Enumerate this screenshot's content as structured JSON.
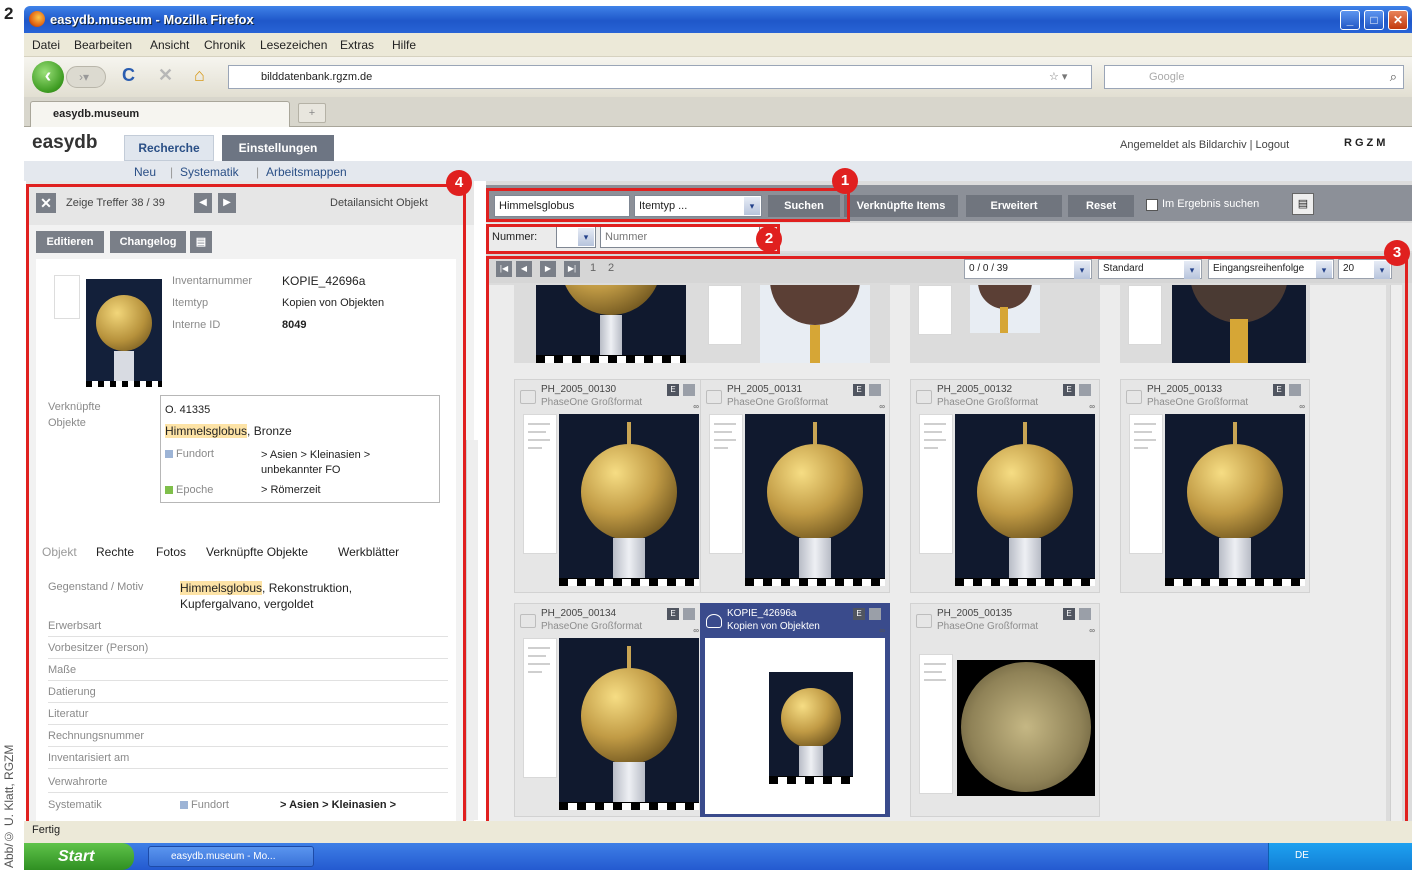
{
  "figure_number": "2",
  "photo_credit": "Abb/© U. Klatt, RGZM",
  "window": {
    "title": "easydb.museum - Mozilla Firefox"
  },
  "menu": [
    "Datei",
    "Bearbeiten",
    "Ansicht",
    "Chronik",
    "Lesezeichen",
    "Extras",
    "Hilfe"
  ],
  "browser": {
    "url": "bilddatenbank.rgzm.de",
    "search_placeholder": "Google",
    "tab_title": "easydb.museum",
    "new_tab": "+"
  },
  "app": {
    "logo": "easydb",
    "tabs": [
      "Recherche",
      "Einstellungen"
    ],
    "login_text": "Angemeldet als Bildarchiv | Logout",
    "brand": "RGZM",
    "subnav": [
      "Neu",
      "Systematik",
      "Arbeitsmappen"
    ]
  },
  "detail": {
    "hits": "Zeige Treffer 38 / 39",
    "view_label": "Detailansicht Objekt",
    "edit": "Editieren",
    "changelog": "Changelog",
    "fields": [
      {
        "label": "Inventarnummer",
        "value": "KOPIE_42696a"
      },
      {
        "label": "Itemtyp",
        "value": "Kopien von Objekten"
      },
      {
        "label": "Interne ID",
        "value": "8049"
      }
    ],
    "linked_label": "Verknüpfte Objekte",
    "linked": {
      "number": "O. 41335",
      "highlight": "Himmelsglobus",
      "rest": ", Bronze",
      "fundort_label": "Fundort",
      "fundort": "> Asien > Kleinasien > unbekannter FO",
      "epoche_label": "Epoche",
      "epoche": "> Römerzeit"
    },
    "tabs": [
      "Objekt",
      "Rechte",
      "Fotos",
      "Verknüpfte Objekte",
      "Werkblätter"
    ],
    "gegenstand_label": "Gegenstand / Motiv",
    "gegenstand_highlight": "Himmelsglobus",
    "gegenstand_rest": ", Rekonstruktion, Kupfergalvano, vergoldet",
    "rows": [
      "Erwerbsart",
      "Vorbesitzer (Person)",
      "Maße",
      "Datierung",
      "Literatur",
      "Rechnungsnummer",
      "Inventarisiert am",
      "Verwahrorte"
    ],
    "systematik_label": "Systematik",
    "systematik_fundort": "Fundort",
    "systematik_value": "> Asien > Kleinasien >"
  },
  "search": {
    "query": "Himmelsglobus",
    "itemtyp": "Itemtyp ...",
    "buttons": [
      "Suchen",
      "Verknüpfte Items",
      "Erweitert",
      "Reset"
    ],
    "within": "Im Ergebnis suchen",
    "nummer_label": "Nummer:",
    "nummer_placeholder": "Nummer"
  },
  "results": {
    "pages": [
      "1",
      "2"
    ],
    "count": "0 / 0 / 39",
    "view": "Standard",
    "sort": "Eingangsreihenfolge",
    "per_page": "20",
    "badge": "E",
    "items": [
      {
        "id": "PH_2005_00130",
        "type": "PhaseOne Großformat"
      },
      {
        "id": "PH_2005_00131",
        "type": "PhaseOne Großformat"
      },
      {
        "id": "PH_2005_00132",
        "type": "PhaseOne Großformat"
      },
      {
        "id": "PH_2005_00133",
        "type": "PhaseOne Großformat"
      },
      {
        "id": "PH_2005_00134",
        "type": "PhaseOne Großformat"
      },
      {
        "id": "KOPIE_42696a",
        "type": "Kopien von Objekten"
      },
      {
        "id": "PH_2005_00135",
        "type": "PhaseOne Großformat"
      }
    ]
  },
  "annotations": [
    "1",
    "2",
    "3",
    "4"
  ],
  "status": "Fertig",
  "taskbar": {
    "start": "Start",
    "item": "easydb.museum - Mo...",
    "lang": "DE"
  },
  "colors": {
    "annotation": "#e0201f",
    "titlebar": "#245ad0",
    "selected_card": "#3a4b8c"
  }
}
